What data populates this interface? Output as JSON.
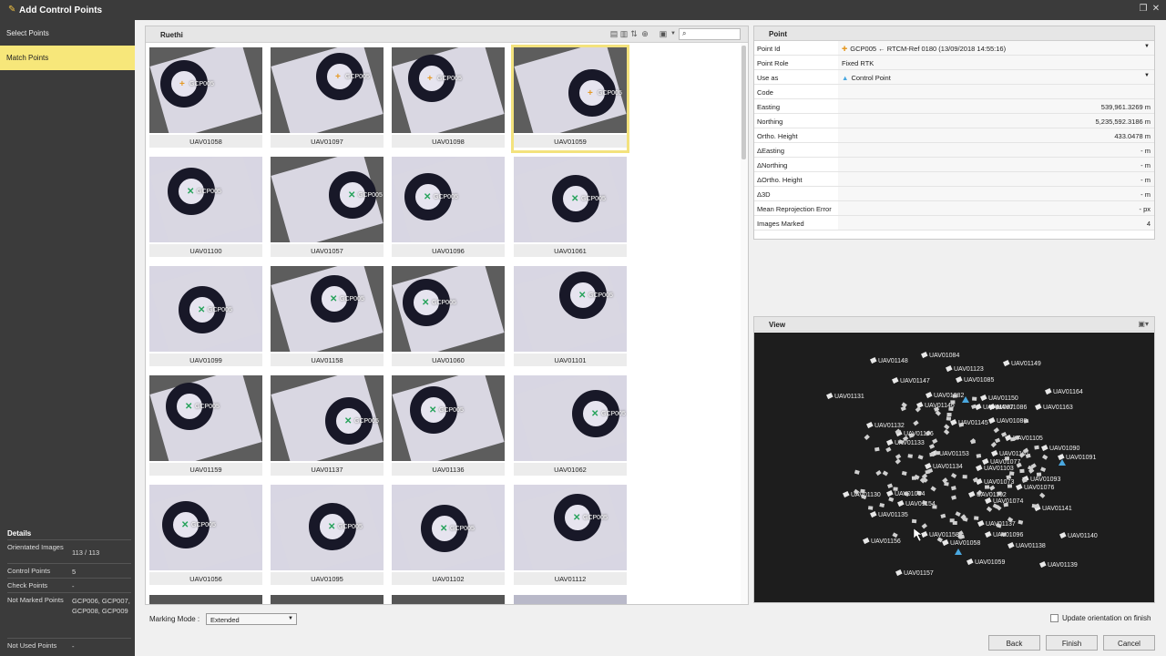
{
  "window": {
    "title": "Add Control Points"
  },
  "sidebar": {
    "items": [
      {
        "label": "Select Points",
        "active": false
      },
      {
        "label": "Match Points",
        "active": true
      }
    ],
    "details": {
      "title": "Details",
      "rows": [
        {
          "key": "Orientated Images",
          "value": "113 / 113"
        },
        {
          "key": "Control Points",
          "value": "5"
        },
        {
          "key": "Check Points",
          "value": "-"
        },
        {
          "key": "Not Marked Points",
          "value": "GCP006, GCP007, GCP008, GCP009"
        },
        {
          "key": "Not Used Points",
          "value": "-"
        }
      ]
    }
  },
  "images_panel": {
    "title": "Ruethi",
    "search_placeholder": "",
    "tiles": [
      {
        "caption": "UAV01058",
        "marker": "orange",
        "label": "GCP005",
        "selected": false
      },
      {
        "caption": "UAV01097",
        "marker": "orange",
        "label": "GCP005",
        "selected": false
      },
      {
        "caption": "UAV01098",
        "marker": "orange",
        "label": "GCP005",
        "selected": false
      },
      {
        "caption": "UAV01059",
        "marker": "orange",
        "label": "GCP005",
        "selected": true
      },
      {
        "caption": "UAV01100",
        "marker": "green",
        "label": "GCP005",
        "selected": false
      },
      {
        "caption": "UAV01057",
        "marker": "green",
        "label": "GCP005",
        "selected": false
      },
      {
        "caption": "UAV01096",
        "marker": "green",
        "label": "GCP005",
        "selected": false
      },
      {
        "caption": "UAV01061",
        "marker": "green",
        "label": "GCP005",
        "selected": false
      },
      {
        "caption": "UAV01099",
        "marker": "green",
        "label": "GCP005",
        "selected": false
      },
      {
        "caption": "UAV01158",
        "marker": "green",
        "label": "GCP005",
        "selected": false
      },
      {
        "caption": "UAV01060",
        "marker": "green",
        "label": "GCP005",
        "selected": false
      },
      {
        "caption": "UAV01101",
        "marker": "green",
        "label": "GCP005",
        "selected": false
      },
      {
        "caption": "UAV01159",
        "marker": "green",
        "label": "GCP005",
        "selected": false
      },
      {
        "caption": "UAV01137",
        "marker": "green",
        "label": "GCP005",
        "selected": false
      },
      {
        "caption": "UAV01136",
        "marker": "green",
        "label": "GCP005",
        "selected": false
      },
      {
        "caption": "UAV01062",
        "marker": "green",
        "label": "GCP005",
        "selected": false
      },
      {
        "caption": "UAV01056",
        "marker": "green",
        "label": "GCP005",
        "selected": false
      },
      {
        "caption": "UAV01095",
        "marker": "green",
        "label": "GCP005",
        "selected": false
      },
      {
        "caption": "UAV01102",
        "marker": "green",
        "label": "GCP005",
        "selected": false
      },
      {
        "caption": "UAV01112",
        "marker": "green",
        "label": "GCP005",
        "selected": false
      }
    ]
  },
  "marking_mode": {
    "label": "Marking Mode :",
    "value": "Extended"
  },
  "point_panel": {
    "title": "Point",
    "rows": [
      {
        "key": "Point Id",
        "value": "GCP005 ← RTCM-Ref 0180 (13/09/2018 14:55:16)",
        "align": "left",
        "dropdown": true,
        "icon": "plus-marker-icon"
      },
      {
        "key": "Point Role",
        "value": "Fixed RTK",
        "align": "left",
        "dropdown": false,
        "icon": ""
      },
      {
        "key": "Use as",
        "value": "Control Point",
        "align": "left",
        "dropdown": true,
        "icon": "triangle-icon"
      },
      {
        "key": "Code",
        "value": "",
        "align": "left",
        "dropdown": false,
        "icon": ""
      },
      {
        "key": "Easting",
        "value": "539,961.3269 m",
        "align": "right",
        "dropdown": false,
        "icon": ""
      },
      {
        "key": "Northing",
        "value": "5,235,592.3186 m",
        "align": "right",
        "dropdown": false,
        "icon": ""
      },
      {
        "key": "Ortho. Height",
        "value": "433.0478 m",
        "align": "right",
        "dropdown": false,
        "icon": ""
      },
      {
        "key": "ΔEasting",
        "value": "- m",
        "align": "right",
        "dropdown": false,
        "icon": ""
      },
      {
        "key": "ΔNorthing",
        "value": "- m",
        "align": "right",
        "dropdown": false,
        "icon": ""
      },
      {
        "key": "ΔOrtho. Height",
        "value": "- m",
        "align": "right",
        "dropdown": false,
        "icon": ""
      },
      {
        "key": "Δ3D",
        "value": "- m",
        "align": "right",
        "dropdown": false,
        "icon": ""
      },
      {
        "key": "Mean Reprojection Error",
        "value": "- px",
        "align": "right",
        "dropdown": false,
        "icon": ""
      },
      {
        "key": "Images Marked",
        "value": "4",
        "align": "right",
        "dropdown": false,
        "icon": ""
      }
    ]
  },
  "view_panel": {
    "title": "View",
    "camera_labels": [
      "UAV01148",
      "UAV01084",
      "UAV01149",
      "UAV01123",
      "UAV01147",
      "UAV01085",
      "UAV01131",
      "UAV01164",
      "UAV01082",
      "UAV01146",
      "UAV01150",
      "UAV01163",
      "UAV01086",
      "UAV01087",
      "UAV01145",
      "UAV01132",
      "UAV01088",
      "UAV01126",
      "UAV01090",
      "UAV01091",
      "UAV01105",
      "UAV01133",
      "UAV01153",
      "UAV01161",
      "UAV01077",
      "UAV01134",
      "UAV01093",
      "UAV01103",
      "UAV01073",
      "UAV01076",
      "UAV01130",
      "UAV01054",
      "UAV01102",
      "UAV01154",
      "UAV01135",
      "UAV01074",
      "UAV01141",
      "UAV01137",
      "UAV01158",
      "UAV01096",
      "UAV01140",
      "UAV01156",
      "UAV01138",
      "UAV01058",
      "UAV01059",
      "UAV01157",
      "UAV01139"
    ]
  },
  "footer": {
    "update_label": "Update orientation on finish",
    "back": "Back",
    "finish": "Finish",
    "cancel": "Cancel"
  }
}
